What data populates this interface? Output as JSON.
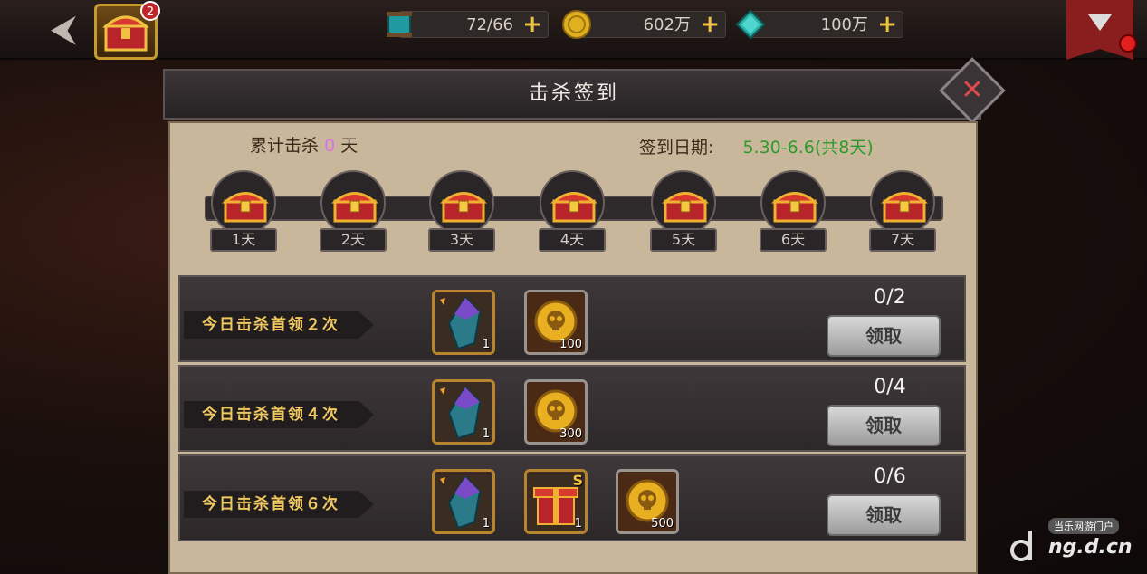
{
  "topbar": {
    "notification_count": "2",
    "resources": [
      {
        "icon": "thread-spool-icon",
        "value": "72/66"
      },
      {
        "icon": "gold-coin-icon",
        "value": "602万"
      },
      {
        "icon": "diamond-icon",
        "value": "100万"
      }
    ]
  },
  "dialog": {
    "title": "击杀签到",
    "cumulative_prefix": "累计击杀",
    "cumulative_count": "0",
    "cumulative_suffix": "天",
    "date_label": "签到日期:",
    "date_range": "5.30-6.6(共8天)"
  },
  "milestones": [
    {
      "day": "1天"
    },
    {
      "day": "2天"
    },
    {
      "day": "3天"
    },
    {
      "day": "4天"
    },
    {
      "day": "5天"
    },
    {
      "day": "6天"
    },
    {
      "day": "7天"
    }
  ],
  "tasks": [
    {
      "label": "今日击杀首领２次",
      "progress": "0/2",
      "button": "领取",
      "rewards": [
        {
          "icon": "crystal-icon",
          "count": "1"
        },
        {
          "icon": "skull-coin-icon",
          "count": "100"
        }
      ]
    },
    {
      "label": "今日击杀首领４次",
      "progress": "0/4",
      "button": "领取",
      "rewards": [
        {
          "icon": "crystal-icon",
          "count": "1"
        },
        {
          "icon": "skull-coin-icon",
          "count": "300"
        }
      ]
    },
    {
      "label": "今日击杀首领６次",
      "progress": "0/6",
      "button": "领取",
      "rewards": [
        {
          "icon": "crystal-icon",
          "count": "1"
        },
        {
          "icon": "gift-box-icon",
          "count": "1",
          "mark": "S"
        },
        {
          "icon": "skull-coin-icon",
          "count": "500"
        }
      ]
    }
  ],
  "watermark": {
    "tag": "当乐网游门户",
    "text": "ng.d.cn"
  }
}
